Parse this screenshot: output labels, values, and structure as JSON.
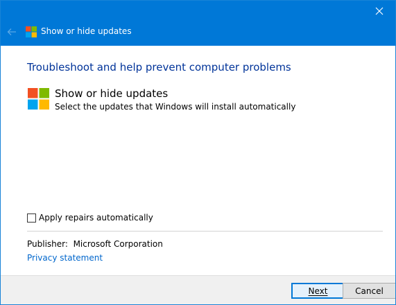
{
  "window": {
    "title": "Show or hide updates"
  },
  "content": {
    "heading": "Troubleshoot and help prevent computer problems",
    "tool_name": "Show or hide updates",
    "tool_description": "Select the updates that Windows will install automatically",
    "apply_repairs_label": "Apply repairs automatically",
    "apply_repairs_checked": false,
    "publisher_label": "Publisher:",
    "publisher_value": "Microsoft Corporation",
    "privacy_link": "Privacy statement"
  },
  "footer": {
    "next_label": "Next",
    "cancel_label": "Cancel"
  },
  "icons": {
    "close": "close-icon",
    "back": "back-arrow-icon",
    "logo": "windows-logo-icon"
  },
  "colors": {
    "titlebar": "#0078d7",
    "heading": "#003399",
    "link": "#0066cc",
    "logo_red": "#f25022",
    "logo_green": "#7fba00",
    "logo_blue": "#00a4ef",
    "logo_yellow": "#ffb900"
  }
}
